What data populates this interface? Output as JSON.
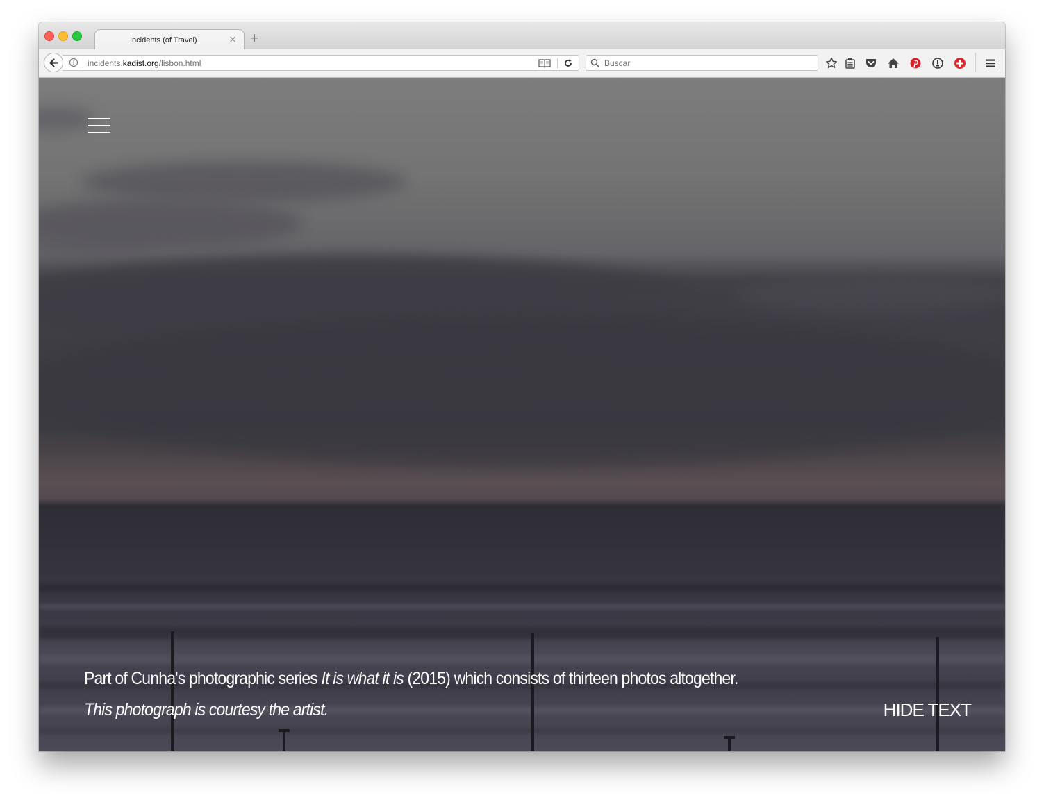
{
  "browser": {
    "tab_title": "Incidents (of Travel)",
    "tab_close": "×",
    "new_tab": "+",
    "url_prefix": "incidents.",
    "url_domain": "kadist.org",
    "url_path": "/lisbon.html",
    "search_placeholder": "Buscar",
    "info_glyph": "i",
    "toolbar_icons": [
      "bookmark-star-icon",
      "reading-list-icon",
      "pocket-icon",
      "home-icon",
      "pinterest-icon",
      "password-manager-icon",
      "adblock-plus-icon",
      "menu-icon"
    ]
  },
  "page": {
    "caption_part1": "Part of Cunha's photographic series ",
    "caption_series": "It is what it is",
    "caption_part2": " (2015) which consists of thirteen photos altogether. ",
    "caption_credit": "This photograph is courtesy the artist.",
    "hide_text_label": "HIDE TEXT"
  }
}
